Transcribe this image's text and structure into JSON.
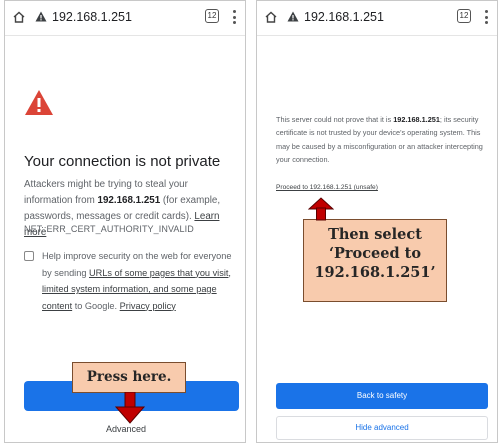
{
  "left_screen": {
    "url": "192.168.1.251",
    "tab_count": "12",
    "title": "Your connection is not private",
    "body_prefix": "Attackers might be trying to steal your information from ",
    "body_host": "192.168.1.251",
    "body_suffix": " (for example, passwords, messages or credit cards). ",
    "learn_more": "Learn more",
    "error_code": "NET::ERR_CERT_AUTHORITY_INVALID",
    "help_prefix": "Help improve security on the web for everyone by sending ",
    "help_link": "URLs of some pages that you visit, limited system information, and some page content",
    "help_suffix": " to Google. ",
    "privacy_policy": "Privacy policy",
    "advanced": "Advanced"
  },
  "right_screen": {
    "url": "192.168.1.251",
    "tab_count": "12",
    "body_prefix": "This server could not prove that it is ",
    "body_host": "192.168.1.251",
    "body_suffix": "; its security certificate is not trusted by your device's operating system. This may be caused by a misconfiguration or an attacker intercepting your connection.",
    "proceed_link": "Proceed to 192.168.1.251 (unsafe)",
    "back_to_safety": "Back to safety",
    "hide_advanced": "Hide advanced"
  },
  "annotations": {
    "left_callout": "Press here.",
    "right_callout_line1": "Then select",
    "right_callout_line2": "‘Proceed to",
    "right_callout_line3": "192.168.1.251’"
  },
  "colors": {
    "warning_red": "#db4437",
    "primary_blue": "#1a73e8",
    "callout_fill": "#f8cbad",
    "arrow_red": "#c00000"
  },
  "icons": [
    "home-icon",
    "warning-icon",
    "tab-switcher-icon",
    "more-vert-icon",
    "arrow-down-icon",
    "arrow-up-icon"
  ]
}
